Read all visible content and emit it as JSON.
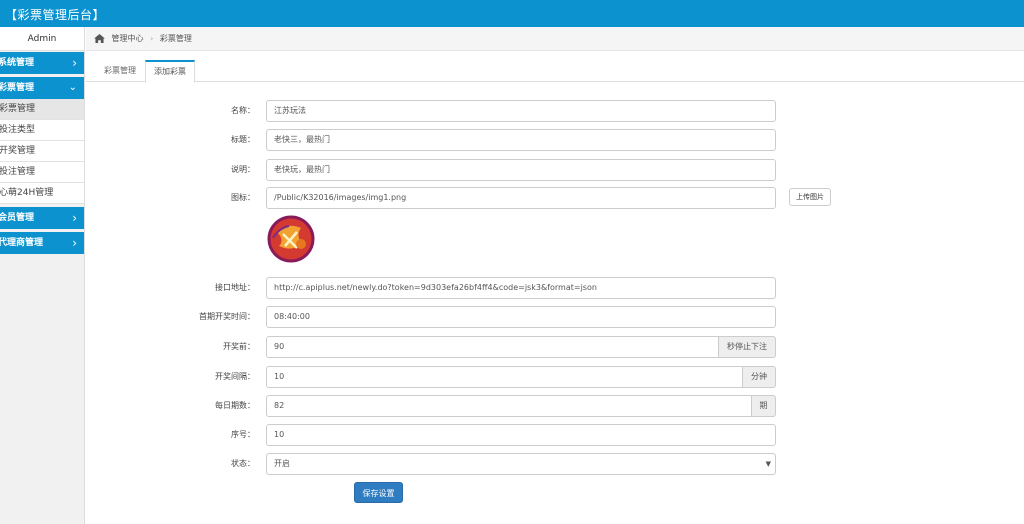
{
  "app": {
    "title": "【彩票管理后台】",
    "brand_color": "#0c93cf"
  },
  "sidebar": {
    "user": "Admin",
    "groups": [
      {
        "label": "系统管理",
        "icon": "chevron-right-icon"
      },
      {
        "label": "彩票管理",
        "icon": "chevron-down-icon"
      },
      {
        "label": "会员管理",
        "icon": "chevron-right-icon"
      },
      {
        "label": "代理商管理",
        "icon": "chevron-right-icon"
      }
    ],
    "lottery_items": [
      {
        "label": "彩票管理"
      },
      {
        "label": "投注类型"
      },
      {
        "label": "开奖管理"
      },
      {
        "label": "投注管理"
      },
      {
        "label": "心萌24H管理"
      }
    ]
  },
  "breadcrumb": {
    "home": "管理中心",
    "current": "彩票管理"
  },
  "tabs": [
    {
      "label": "彩票管理"
    },
    {
      "label": "添加彩票"
    }
  ],
  "form": {
    "name": {
      "label": "名称：",
      "value": "江苏玩法"
    },
    "title": {
      "label": "标题：",
      "value": "老快三，最热门"
    },
    "desc": {
      "label": "说明：",
      "value": "老快玩，最热门"
    },
    "icon": {
      "label": "图标：",
      "value": "/Public/K32016/images/img1.png",
      "upload_label": "上传图片"
    },
    "api": {
      "label": "接口地址：",
      "value": "http://c.apiplus.net/newly.do?token=9d303efa26bf4ff4&code=jsk3&format=json"
    },
    "first_time": {
      "label": "首期开奖时间：",
      "value": "08:40:00"
    },
    "before": {
      "label": "开奖前：",
      "value": "90",
      "addon": "秒停止下注"
    },
    "interval": {
      "label": "开奖间隔：",
      "value": "10",
      "addon": "分钟"
    },
    "daily": {
      "label": "每日期数：",
      "value": "82",
      "addon": "期"
    },
    "order": {
      "label": "序号：",
      "value": "10"
    },
    "status": {
      "label": "状态：",
      "value": "开启"
    },
    "save_label": "保存设置"
  }
}
